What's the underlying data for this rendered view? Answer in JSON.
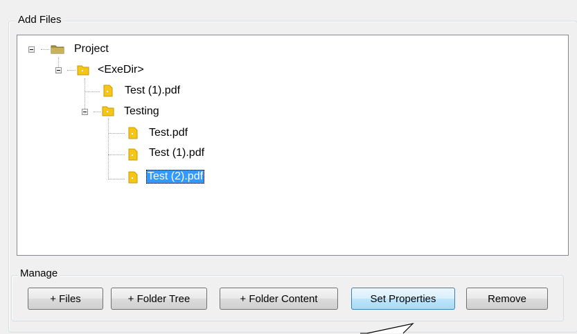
{
  "add_files": {
    "title": "Add Files",
    "tree": {
      "project": "Project",
      "exedir": "<ExeDir>",
      "exedir_file": "Test (1).pdf",
      "testing": "Testing",
      "testing_files": [
        "Test.pdf",
        "Test (1).pdf",
        "Test (2).pdf"
      ]
    }
  },
  "manage": {
    "title": "Manage",
    "buttons": {
      "files": "+ Files",
      "folder_tree": "+ Folder Tree",
      "folder_content": "+ Folder Content",
      "set_properties": "Set Properties",
      "remove": "Remove"
    }
  },
  "colors": {
    "selection": "#3399ff",
    "folder": "#f5c518",
    "project_folder": "#b5a04a"
  }
}
